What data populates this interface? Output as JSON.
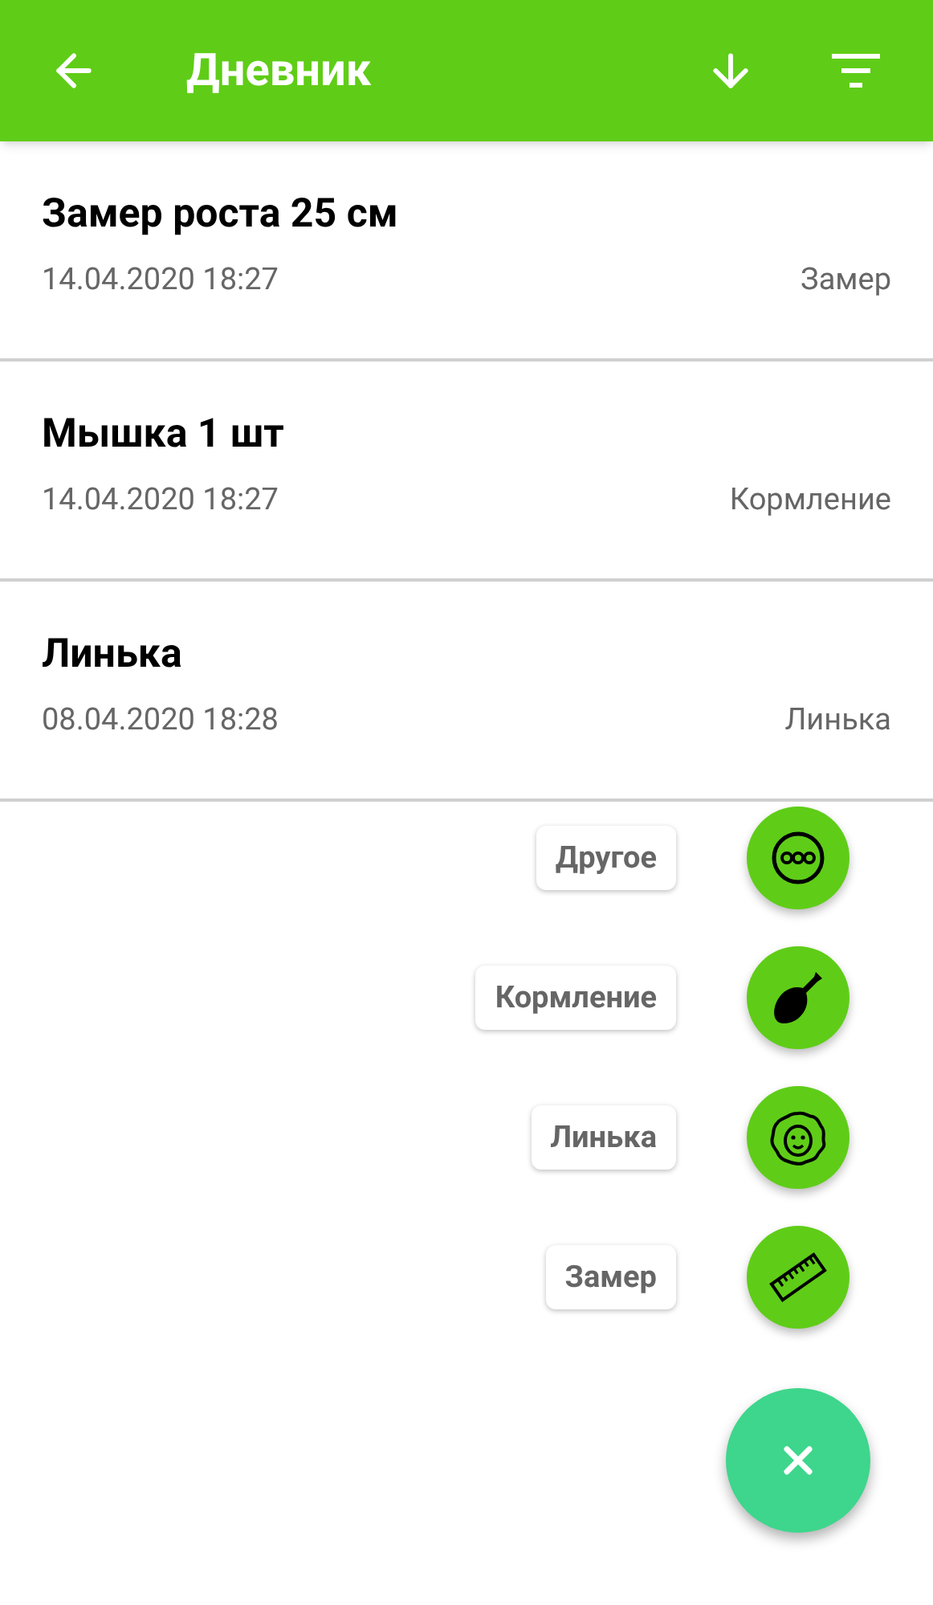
{
  "app_bar": {
    "title": "Дневник"
  },
  "entries": [
    {
      "title": "Замер роста 25 см",
      "date": "14.04.2020 18:27",
      "category": "Замер"
    },
    {
      "title": "Мышка 1 шт",
      "date": "14.04.2020 18:27",
      "category": "Кормление"
    },
    {
      "title": "Линька",
      "date": "08.04.2020 18:28",
      "category": "Линька"
    }
  ],
  "fab_menu": {
    "expanded": true,
    "actions": [
      {
        "kind": "other",
        "label": "Другое"
      },
      {
        "kind": "feeding",
        "label": "Кормление"
      },
      {
        "kind": "molt",
        "label": "Линька"
      },
      {
        "kind": "measure",
        "label": "Замер"
      }
    ]
  }
}
